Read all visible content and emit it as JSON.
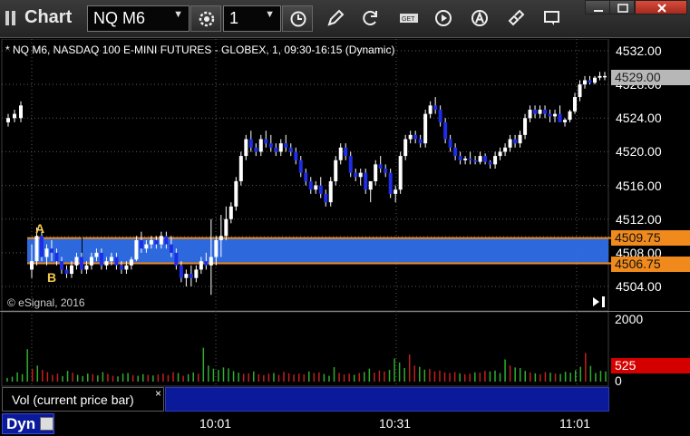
{
  "window": {
    "title": "Chart"
  },
  "toolbar": {
    "symbol": "NQ M6",
    "interval": "1",
    "buttons": [
      "settings-icon",
      "clock-icon",
      "draw-pencil-icon",
      "refresh-icon",
      "get-icon",
      "play-icon",
      "alert-icon",
      "link-icon",
      "comment-icon"
    ]
  },
  "chart": {
    "header": "* NQ M6, NASDAQ 100 E-MINI FUTURES - GLOBEX, 1, 09:30-16:15 (Dynamic)",
    "copyright": "© eSignal, 2016",
    "price_ticks": [
      "4532.00",
      "4528.00",
      "4524.00",
      "4520.00",
      "4516.00",
      "4512.00",
      "4508.00",
      "4504.00"
    ],
    "tags": {
      "last": "4529.00",
      "zone_high": "4509.75",
      "zone_low": "4506.75"
    },
    "zone_labels": {
      "a": "A",
      "b": "B"
    },
    "colors": {
      "up_candle": "#ffffff",
      "down_candle": "#1e2de8",
      "zone_fill": "#2f6fe8",
      "zone_border": "#f08a1c",
      "vol_up": "#2fae2f",
      "vol_down": "#c02020",
      "vol_tag": "#d40000"
    }
  },
  "volume": {
    "ticks": [
      "2000",
      "0"
    ],
    "current": "525",
    "study_label": "Vol (current price bar)",
    "close_label": "×"
  },
  "time_axis": {
    "mode": "Dyn",
    "ticks": [
      "10:01",
      "10:31",
      "11:01"
    ]
  },
  "chart_data": {
    "type": "candlestick",
    "title": "* NQ M6, NASDAQ 100 E-MINI FUTURES - GLOBEX, 1, 09:30-16:15 (Dynamic)",
    "ylim": [
      4502,
      4534
    ],
    "x_ticks": [
      "10:01",
      "10:31",
      "11:01"
    ],
    "zone": {
      "high": 4509.75,
      "low": 4506.75
    },
    "last": 4529.0,
    "candles": [
      [
        4523.5,
        4524.5,
        4523,
        4524
      ],
      [
        4524,
        4525,
        4523.5,
        4524.5
      ],
      [
        4524,
        4526,
        4523.5,
        4525.5
      ],
      [
        4506,
        4509,
        4505,
        4507
      ],
      [
        4507,
        4511,
        4506.5,
        4510
      ],
      [
        4510,
        4510.5,
        4507,
        4507.5
      ],
      [
        4507.5,
        4509,
        4506.5,
        4508.5
      ],
      [
        4508.5,
        4509.5,
        4507,
        4508
      ],
      [
        4508,
        4508.5,
        4506.5,
        4507
      ],
      [
        4507,
        4507.5,
        4505.5,
        4506
      ],
      [
        4506,
        4506.5,
        4505,
        4505.5
      ],
      [
        4505.5,
        4507,
        4505,
        4506.5
      ],
      [
        4506.5,
        4508,
        4506,
        4507.5
      ],
      [
        4507.5,
        4508,
        4505.5,
        4506
      ],
      [
        4506,
        4507,
        4505.5,
        4506.5
      ],
      [
        4506.5,
        4508,
        4506,
        4507.5
      ],
      [
        4507.5,
        4508.5,
        4507,
        4508
      ],
      [
        4508,
        4508.5,
        4506,
        4506.5
      ],
      [
        4506.5,
        4507.5,
        4506,
        4507
      ],
      [
        4507,
        4508,
        4506.5,
        4507.5
      ],
      [
        4507.5,
        4508,
        4506,
        4506.5
      ],
      [
        4506.5,
        4507,
        4505.5,
        4506
      ],
      [
        4506,
        4507,
        4505.5,
        4506.5
      ],
      [
        4506.5,
        4507.5,
        4506,
        4507.2
      ],
      [
        4507.2,
        4510,
        4507,
        4509.5
      ],
      [
        4509.5,
        4510.5,
        4508,
        4508.5
      ],
      [
        4508.5,
        4509.5,
        4508,
        4509
      ],
      [
        4509,
        4510,
        4508.5,
        4509.5
      ],
      [
        4509.5,
        4510,
        4508.5,
        4509
      ],
      [
        4509,
        4510.5,
        4508.5,
        4510
      ],
      [
        4510,
        4510.5,
        4508.5,
        4509
      ],
      [
        4509,
        4510,
        4507.5,
        4508
      ],
      [
        4508,
        4508.5,
        4506,
        4506.5
      ],
      [
        4506.5,
        4507,
        4504.5,
        4505
      ],
      [
        4505,
        4506,
        4504,
        4505.5
      ],
      [
        4505.5,
        4506.5,
        4504,
        4505
      ],
      [
        4505,
        4506.5,
        4504.5,
        4506
      ],
      [
        4506,
        4507.5,
        4505.5,
        4507
      ],
      [
        4507,
        4508,
        4506,
        4506.5
      ],
      [
        4506.5,
        4512,
        4503,
        4507.5
      ],
      [
        4507.5,
        4510,
        4506.5,
        4509.5
      ],
      [
        4509.5,
        4512.5,
        4507.5,
        4510
      ],
      [
        4510,
        4513.5,
        4509.5,
        4512
      ],
      [
        4512,
        4514,
        4511.5,
        4513.5
      ],
      [
        4513.5,
        4517,
        4513,
        4516.5
      ],
      [
        4516.5,
        4520,
        4516,
        4519.5
      ],
      [
        4519.5,
        4522,
        4519,
        4521.5
      ],
      [
        4521.5,
        4522.5,
        4520,
        4520.5
      ],
      [
        4520.5,
        4521,
        4519.5,
        4520
      ],
      [
        4520,
        4522,
        4519.5,
        4521.5
      ],
      [
        4521.5,
        4522.5,
        4520.5,
        4521
      ],
      [
        4521,
        4522,
        4520,
        4520.5
      ],
      [
        4520.5,
        4521,
        4519.5,
        4520
      ],
      [
        4520,
        4521.5,
        4519.5,
        4521
      ],
      [
        4521,
        4522,
        4520,
        4520.5
      ],
      [
        4520.5,
        4521,
        4519.5,
        4520
      ],
      [
        4520,
        4520.5,
        4518.5,
        4519
      ],
      [
        4519,
        4519.5,
        4517,
        4517.5
      ],
      [
        4517.5,
        4518,
        4516,
        4516.5
      ],
      [
        4516.5,
        4517,
        4515,
        4515.5
      ],
      [
        4515.5,
        4516.5,
        4515,
        4516
      ],
      [
        4516,
        4517,
        4514.5,
        4515
      ],
      [
        4515,
        4515.5,
        4513.5,
        4514
      ],
      [
        4514,
        4517,
        4513.5,
        4516.5
      ],
      [
        4516.5,
        4519.5,
        4516,
        4519
      ],
      [
        4519,
        4521,
        4518.5,
        4520.5
      ],
      [
        4520.5,
        4521,
        4519,
        4519.5
      ],
      [
        4519.5,
        4520,
        4517,
        4517.5
      ],
      [
        4517.5,
        4518,
        4516.5,
        4517
      ],
      [
        4517,
        4518,
        4516,
        4517.5
      ],
      [
        4517.5,
        4518,
        4515,
        4515.5
      ],
      [
        4515.5,
        4516,
        4514,
        4516.5
      ],
      [
        4516.5,
        4519,
        4516,
        4518.5
      ],
      [
        4518.5,
        4519.5,
        4517.5,
        4518
      ],
      [
        4518,
        4518.5,
        4517,
        4517.5
      ],
      [
        4517.5,
        4518,
        4514.5,
        4515
      ],
      [
        4515,
        4516,
        4514,
        4515.5
      ],
      [
        4515.5,
        4520,
        4515,
        4519.5
      ],
      [
        4519.5,
        4522,
        4519,
        4521.5
      ],
      [
        4521.5,
        4522.5,
        4521,
        4522
      ],
      [
        4522,
        4522.5,
        4521,
        4521.5
      ],
      [
        4521.5,
        4522,
        4520.5,
        4521
      ],
      [
        4521,
        4525,
        4520.5,
        4524.5
      ],
      [
        4524.5,
        4526,
        4524,
        4525.5
      ],
      [
        4525.5,
        4526.5,
        4524.5,
        4525
      ],
      [
        4525,
        4525.5,
        4523,
        4523.5
      ],
      [
        4523.5,
        4524,
        4521,
        4521.5
      ],
      [
        4521.5,
        4522,
        4520,
        4520.5
      ],
      [
        4520.5,
        4521,
        4519,
        4519.5
      ],
      [
        4519.5,
        4520,
        4518.5,
        4519
      ],
      [
        4519,
        4519.5,
        4518.5,
        4519.2
      ],
      [
        4519.2,
        4520,
        4518.5,
        4519
      ],
      [
        4519,
        4519.5,
        4518.5,
        4518.8
      ],
      [
        4518.8,
        4520,
        4518.5,
        4519.5
      ],
      [
        4519.5,
        4519.8,
        4518.5,
        4518.8
      ],
      [
        4518.8,
        4519,
        4518,
        4518.5
      ],
      [
        4518.5,
        4520,
        4518,
        4519.5
      ],
      [
        4519.5,
        4520.5,
        4519,
        4520
      ],
      [
        4520,
        4521,
        4519.5,
        4520.5
      ],
      [
        4520.5,
        4522,
        4520,
        4521.5
      ],
      [
        4521.5,
        4522,
        4520.5,
        4521
      ],
      [
        4521,
        4522.5,
        4520.5,
        4522
      ],
      [
        4522,
        4524.5,
        4521.5,
        4524
      ],
      [
        4524,
        4525.5,
        4523.5,
        4525
      ],
      [
        4525,
        4525.5,
        4524,
        4524.5
      ],
      [
        4524.5,
        4525.5,
        4524,
        4525
      ],
      [
        4525,
        4525.5,
        4524,
        4524.5
      ],
      [
        4524.5,
        4525,
        4523.5,
        4524.2
      ],
      [
        4524.2,
        4525,
        4523.5,
        4524.5
      ],
      [
        4524.5,
        4525.5,
        4524,
        4523.5
      ],
      [
        4523.5,
        4524,
        4523,
        4523.8
      ],
      [
        4523.8,
        4525,
        4523.5,
        4524.8
      ],
      [
        4524.8,
        4527,
        4524.5,
        4526.5
      ],
      [
        4526.5,
        4528.5,
        4526,
        4528
      ],
      [
        4528,
        4529,
        4527.5,
        4528.5
      ],
      [
        4528.5,
        4529,
        4528,
        4528.2
      ],
      [
        4528.2,
        4529,
        4528,
        4528.8
      ],
      [
        4528.8,
        4529.5,
        4528.5,
        4529
      ],
      [
        4529,
        4529.5,
        4528.5,
        4529
      ]
    ],
    "volume": [
      120,
      160,
      300,
      240,
      1050,
      420,
      520,
      380,
      310,
      220,
      260,
      180,
      350,
      290,
      220,
      180,
      260,
      240,
      200,
      310,
      250,
      190,
      170,
      260,
      280,
      210,
      190,
      240,
      220,
      200,
      230,
      260,
      210,
      310,
      280,
      190,
      240,
      300,
      260,
      1100,
      520,
      420,
      380,
      460,
      430,
      340,
      290,
      250,
      270,
      330,
      240,
      210,
      260,
      280,
      220,
      320,
      270,
      230,
      260,
      240,
      330,
      280,
      300,
      250,
      190,
      470,
      280,
      230,
      260,
      220,
      280,
      310,
      420,
      290,
      360,
      330,
      380,
      750,
      620,
      440,
      880,
      520,
      480,
      390,
      410,
      330,
      360,
      300,
      280,
      310,
      270,
      240,
      260,
      300,
      290,
      350,
      330,
      360,
      280,
      720,
      520,
      460,
      440,
      350,
      300,
      270,
      240,
      310,
      290,
      260,
      250,
      320,
      290,
      370,
      480,
      930,
      510,
      280,
      350,
      330
    ]
  }
}
